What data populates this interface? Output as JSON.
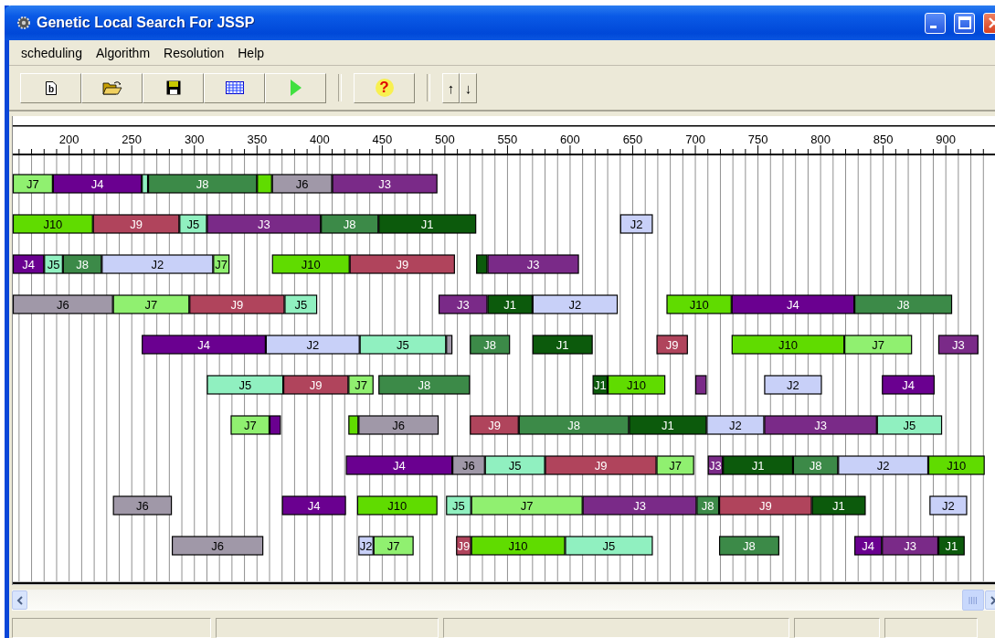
{
  "window": {
    "title": "Genetic Local Search For JSSP"
  },
  "menu": [
    {
      "label": "scheduling"
    },
    {
      "label": "Algorithm"
    },
    {
      "label": "Resolution"
    },
    {
      "label": "Help"
    }
  ],
  "toolbar": {
    "new_glyph": "b",
    "help_glyph": "?",
    "sort_glyphs": [
      "↑",
      "↓"
    ]
  },
  "chart": {
    "chart_data": {
      "type": "bar",
      "orientation": "horizontal",
      "stacked": false,
      "grid": true,
      "xlim": [
        155,
        940
      ],
      "xticks": [
        200,
        250,
        300,
        350,
        400,
        450,
        500,
        550,
        600,
        650,
        700,
        750,
        800,
        850,
        900
      ],
      "series": [
        {
          "name": "J1",
          "color": "#0c5a0c",
          "base": [
            null,
            447,
            525,
            534,
            570,
            618,
            647,
            722,
            793,
            894
          ],
          "values": [
            null,
            78,
            9,
            36,
            48,
            12,
            62,
            56,
            43,
            21
          ]
        },
        {
          "name": "J2",
          "color": "#c8d0f8",
          "base": [
            null,
            640,
            226,
            570,
            357,
            755,
            709,
            814,
            887,
            431
          ],
          "values": [
            null,
            26,
            89,
            68,
            75,
            46,
            46,
            72,
            30,
            12
          ]
        },
        {
          "name": "J3",
          "color": "#7a2a88",
          "base": [
            410,
            310,
            534,
            495,
            894,
            700,
            755,
            710,
            610,
            849
          ],
          "values": [
            84,
            91,
            73,
            39,
            32,
            9,
            90,
            12,
            91,
            45
          ]
        },
        {
          "name": "J4",
          "color": "#6a0090",
          "base": [
            187,
            null,
            150,
            729,
            258,
            849,
            360,
            421,
            370,
            827
          ],
          "values": [
            71,
            null,
            30,
            98,
            99,
            42,
            9,
            85,
            51,
            22
          ]
        },
        {
          "name": "J5",
          "color": "#90f0c0",
          "base": [
            258,
            288,
            180,
            372,
            432,
            310,
            845,
            532,
            501,
            596
          ],
          "values": [
            5,
            22,
            15,
            26,
            69,
            61,
            52,
            48,
            20,
            70
          ]
        },
        {
          "name": "J6",
          "color": "#a098a8",
          "base": [
            362,
            null,
            null,
            150,
            501,
            null,
            431,
            506,
            235,
            282
          ],
          "values": [
            48,
            null,
            null,
            85,
            5,
            null,
            64,
            26,
            47,
            73
          ]
        },
        {
          "name": "J7",
          "color": "#90f070",
          "base": [
            150,
            null,
            315,
            235,
            819,
            423,
            329,
            669,
            521,
            443
          ],
          "values": [
            37,
            null,
            13,
            61,
            54,
            20,
            31,
            30,
            89,
            32
          ]
        },
        {
          "name": "J8",
          "color": "#3c8a48",
          "base": [
            263,
            401,
            195,
            827,
            520,
            447,
            559,
            778,
            701,
            719
          ],
          "values": [
            87,
            46,
            31,
            78,
            32,
            73,
            88,
            36,
            18,
            48
          ]
        },
        {
          "name": "J9",
          "color": "#b0445c",
          "base": [
            null,
            219,
            424,
            296,
            669,
            371,
            520,
            580,
            719,
            509
          ],
          "values": [
            null,
            69,
            84,
            76,
            25,
            52,
            39,
            89,
            74,
            12
          ]
        },
        {
          "name": "J10",
          "color": "#60dc00",
          "base": [
            350,
            150,
            362,
            677,
            729,
            630,
            423,
            886,
            430,
            521
          ],
          "values": [
            12,
            69,
            62,
            52,
            90,
            46,
            8,
            45,
            64,
            75
          ]
        }
      ]
    }
  }
}
